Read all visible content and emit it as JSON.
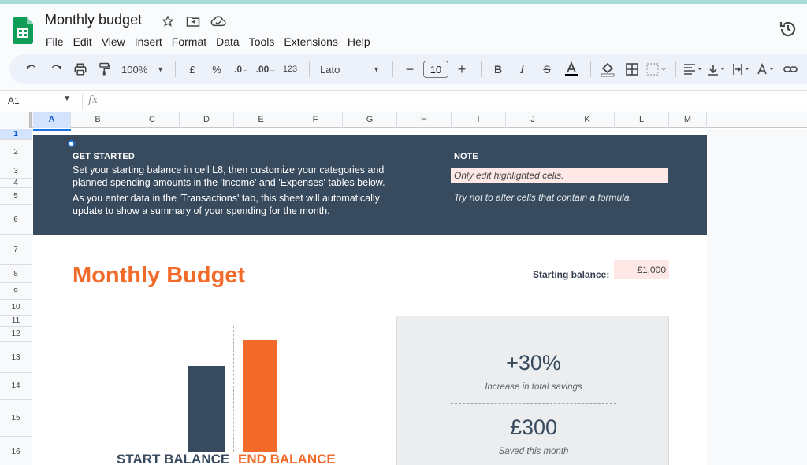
{
  "document": {
    "title": "Monthly budget"
  },
  "menu": [
    "File",
    "Edit",
    "View",
    "Insert",
    "Format",
    "Data",
    "Tools",
    "Extensions",
    "Help"
  ],
  "toolbar": {
    "zoom": "100%",
    "currency": "£",
    "percent": "%",
    "decrease_decimal": ".0",
    "increase_decimal": ".00",
    "number_format": "123",
    "font": "Lato",
    "font_size": "10"
  },
  "formula_bar": {
    "name_box": "A1",
    "fx": "fx"
  },
  "columns": [
    "A",
    "B",
    "C",
    "D",
    "E",
    "F",
    "G",
    "H",
    "I",
    "J",
    "K",
    "L",
    "M"
  ],
  "rows": [
    "1",
    "2",
    "3",
    "4",
    "5",
    "6",
    "7",
    "8",
    "9",
    "10",
    "11",
    "12",
    "13",
    "14",
    "15",
    "16"
  ],
  "banner": {
    "get_started_title": "GET STARTED",
    "get_started_p1": "Set your starting balance in cell L8, then customize your categories and planned spending amounts in the 'Income' and 'Expenses' tables below.",
    "get_started_p2": "As you enter data in the 'Transactions' tab, this sheet will automatically update to show a summary of your spending for the month.",
    "note_title": "NOTE",
    "note_highlight": "Only edit highlighted cells.",
    "note_line2": "Try not to alter cells that contain a formula."
  },
  "budget": {
    "title": "Monthly Budget",
    "starting_balance_label": "Starting balance:",
    "starting_balance_value": "£1,000"
  },
  "chart_data": {
    "type": "bar",
    "categories": [
      "START BALANCE",
      "END BALANCE"
    ],
    "values": [
      1000,
      1300
    ],
    "colors": [
      "#374a5e",
      "#f26b2a"
    ]
  },
  "summary": {
    "pct": "+30%",
    "pct_label": "Increase in total savings",
    "saved": "£300",
    "saved_label": "Saved this month"
  },
  "colors": {
    "accent": "#f26b2a",
    "banner": "#374a5e",
    "highlight": "#fde8e5",
    "selection": "#1a73e8"
  }
}
